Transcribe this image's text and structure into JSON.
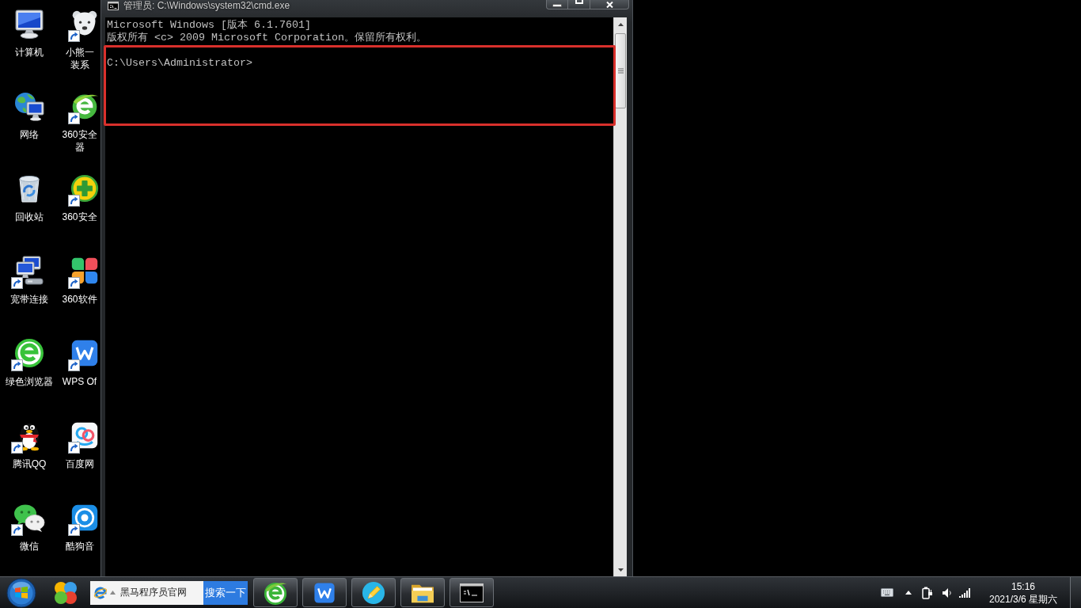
{
  "desktop_icon_columns": [
    {
      "icons": [
        {
          "label_lines": [
            "计算机"
          ],
          "shortcut": false
        },
        {
          "label_lines": [
            "网络"
          ],
          "shortcut": false
        },
        {
          "label_lines": [
            "回收站"
          ],
          "shortcut": false
        },
        {
          "label_lines": [
            "宽带连接"
          ],
          "shortcut": true
        },
        {
          "label_lines": [
            "绿色浏览器"
          ],
          "shortcut": true
        },
        {
          "label_lines": [
            "腾讯QQ"
          ],
          "shortcut": true
        },
        {
          "label_lines": [
            "微信"
          ],
          "shortcut": true
        }
      ]
    },
    {
      "icons": [
        {
          "label_lines": [
            "小熊一",
            "装系"
          ],
          "shortcut": true
        },
        {
          "label_lines": [
            "360安全",
            "器"
          ],
          "shortcut": true
        },
        {
          "label_lines": [
            "360安全"
          ],
          "shortcut": true
        },
        {
          "label_lines": [
            "360软件"
          ],
          "shortcut": true
        },
        {
          "label_lines": [
            "WPS Of"
          ],
          "shortcut": true
        },
        {
          "label_lines": [
            "百度网"
          ],
          "shortcut": true
        },
        {
          "label_lines": [
            "酷狗音"
          ],
          "shortcut": true
        }
      ]
    }
  ],
  "console_window": {
    "title": "管理员: C:\\Windows\\system32\\cmd.exe",
    "output_paragraphs": [
      [
        "Microsoft Windows [版本 6.1.7601]",
        "版权所有 <c> 2009 Microsoft Corporation。保留所有权利。"
      ],
      [
        "C:\\Users\\Administrator>"
      ]
    ]
  },
  "taskbar": {
    "search": {
      "value": "黑马程序员官网",
      "button": "搜索一下"
    },
    "clock": {
      "time": "15:16",
      "date": "2021/3/6 星期六"
    }
  }
}
